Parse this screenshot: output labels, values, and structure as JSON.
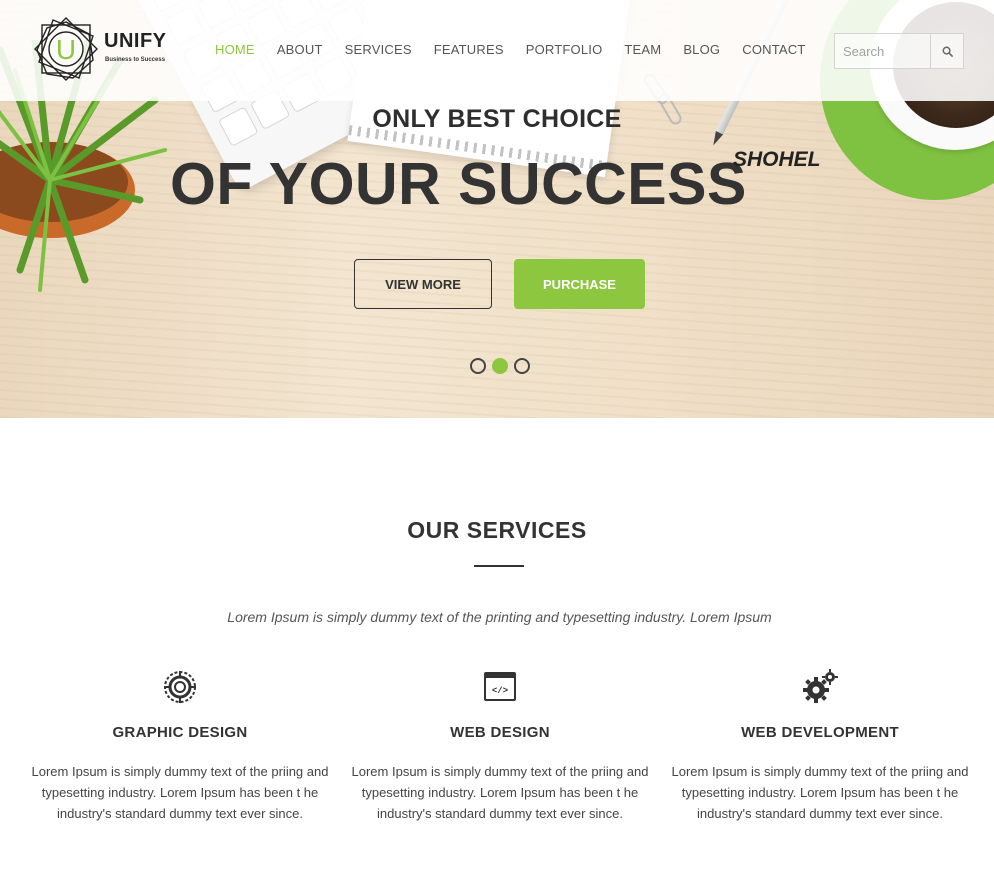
{
  "brand": {
    "name": "UNIFY",
    "tagline": "Business to Success",
    "logo_letter": "U"
  },
  "nav": {
    "items": [
      {
        "label": "HOME",
        "active": true
      },
      {
        "label": "ABOUT",
        "active": false
      },
      {
        "label": "SERVICES",
        "active": false
      },
      {
        "label": "FEATURES",
        "active": false
      },
      {
        "label": "PORTFOLIO",
        "active": false
      },
      {
        "label": "TEAM",
        "active": false
      },
      {
        "label": "BLOG",
        "active": false
      },
      {
        "label": "CONTACT",
        "active": false
      }
    ]
  },
  "search": {
    "placeholder": "Search",
    "icon": "search-icon"
  },
  "hero": {
    "subtitle": "ONLY BEST CHOICE",
    "title": "OF YOUR SUCCESS",
    "signature": "SHOHEL",
    "primary_button": "VIEW MORE",
    "secondary_button": "PURCHASE",
    "slider_dots": 3,
    "active_slide": 2
  },
  "services": {
    "title": "OUR SERVICES",
    "lead": "Lorem Ipsum is simply dummy text of the printing and typesetting industry. Lorem Ipsum",
    "items": [
      {
        "icon": "target-icon",
        "title": "GRAPHIC DESIGN",
        "text": "Lorem Ipsum is simply dummy text of the priing and typesetting industry. Lorem Ipsum has been t he industry's standard dummy text ever since."
      },
      {
        "icon": "code-window-icon",
        "title": "WEB DESIGN",
        "text": "Lorem Ipsum is simply dummy text of the priing and typesetting industry. Lorem Ipsum has been t he industry's standard dummy text ever since."
      },
      {
        "icon": "gears-icon",
        "title": "WEB DEVELOPMENT",
        "text": "Lorem Ipsum is simply dummy text of the priing and typesetting industry. Lorem Ipsum has been t he industry's standard dummy text ever since."
      }
    ]
  },
  "colors": {
    "accent": "#8dc63f",
    "text_dark": "#333333"
  }
}
